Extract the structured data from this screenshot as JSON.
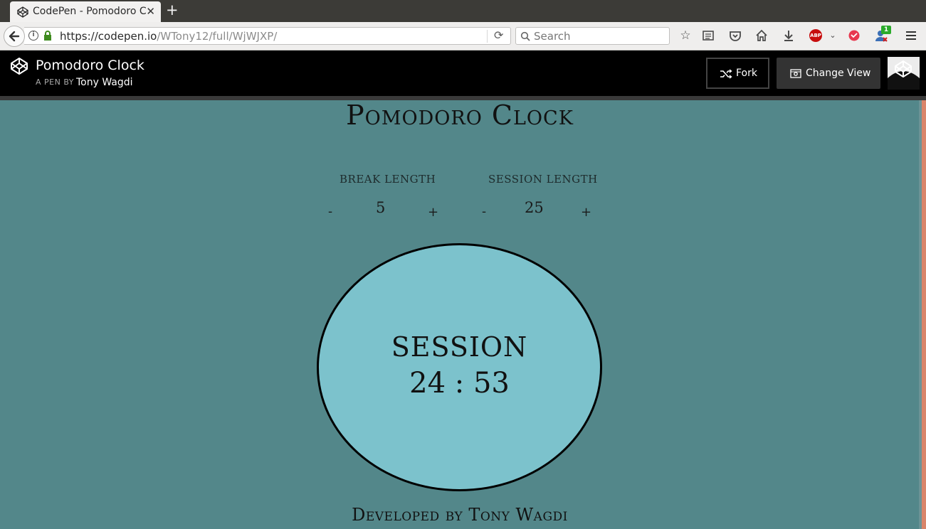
{
  "browser": {
    "tab_title": "CodePen - Pomodoro C",
    "tab_close": "✕",
    "new_tab": "+",
    "url_host": "https://codepen.io",
    "url_path": "/WTony12/full/WjWJXP/",
    "search_placeholder": "Search",
    "addon_badge_count": "1",
    "abp_label": "ABP"
  },
  "codepen": {
    "pen_title": "Pomodoro Clock",
    "byline": "A PEN BY",
    "author": "Tony Wagdi",
    "fork_label": "Fork",
    "change_view_label": "Change View"
  },
  "pomodoro": {
    "title": "Pomodoro Clock",
    "break": {
      "label": "BREAK LENGTH",
      "value": "5",
      "minus": "-",
      "plus": "+"
    },
    "session": {
      "label": "SESSION LENGTH",
      "value": "25",
      "minus": "-",
      "plus": "+"
    },
    "clock": {
      "label": "SESSION",
      "time": "24 : 53"
    },
    "footer": "Developed by Tony Wagdi"
  },
  "colors": {
    "page_background": "#53878a",
    "clock_fill": "#7cc2cc",
    "header_background": "#000000",
    "scrollbar_accent": "#d9856a"
  }
}
